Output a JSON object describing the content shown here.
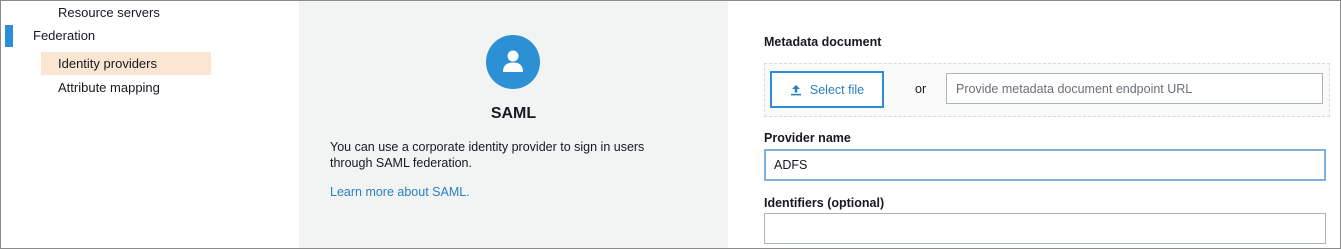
{
  "sidebar": {
    "items": [
      {
        "label": "Resource servers"
      },
      {
        "label": "Federation"
      },
      {
        "label": "Identity providers",
        "selected": true
      },
      {
        "label": "Attribute mapping"
      }
    ]
  },
  "provider_card": {
    "icon": "user-icon",
    "title": "SAML",
    "description": "You can use a corporate identity provider to sign in users through SAML federation.",
    "link": "Learn more about SAML."
  },
  "form": {
    "metadata": {
      "label": "Metadata document",
      "select_button": "Select file",
      "select_icon": "upload-icon",
      "or_text": "or",
      "url_placeholder": "Provide metadata document endpoint URL",
      "url_value": ""
    },
    "provider_name": {
      "label": "Provider name",
      "value": "ADFS"
    },
    "identifiers": {
      "label": "Identifiers (optional)",
      "value": ""
    }
  },
  "colors": {
    "accent": "#2a8fd6",
    "selected_bg": "#fbe5d3",
    "link": "#2a7fc0",
    "panel_bg": "#f2f3f3"
  }
}
